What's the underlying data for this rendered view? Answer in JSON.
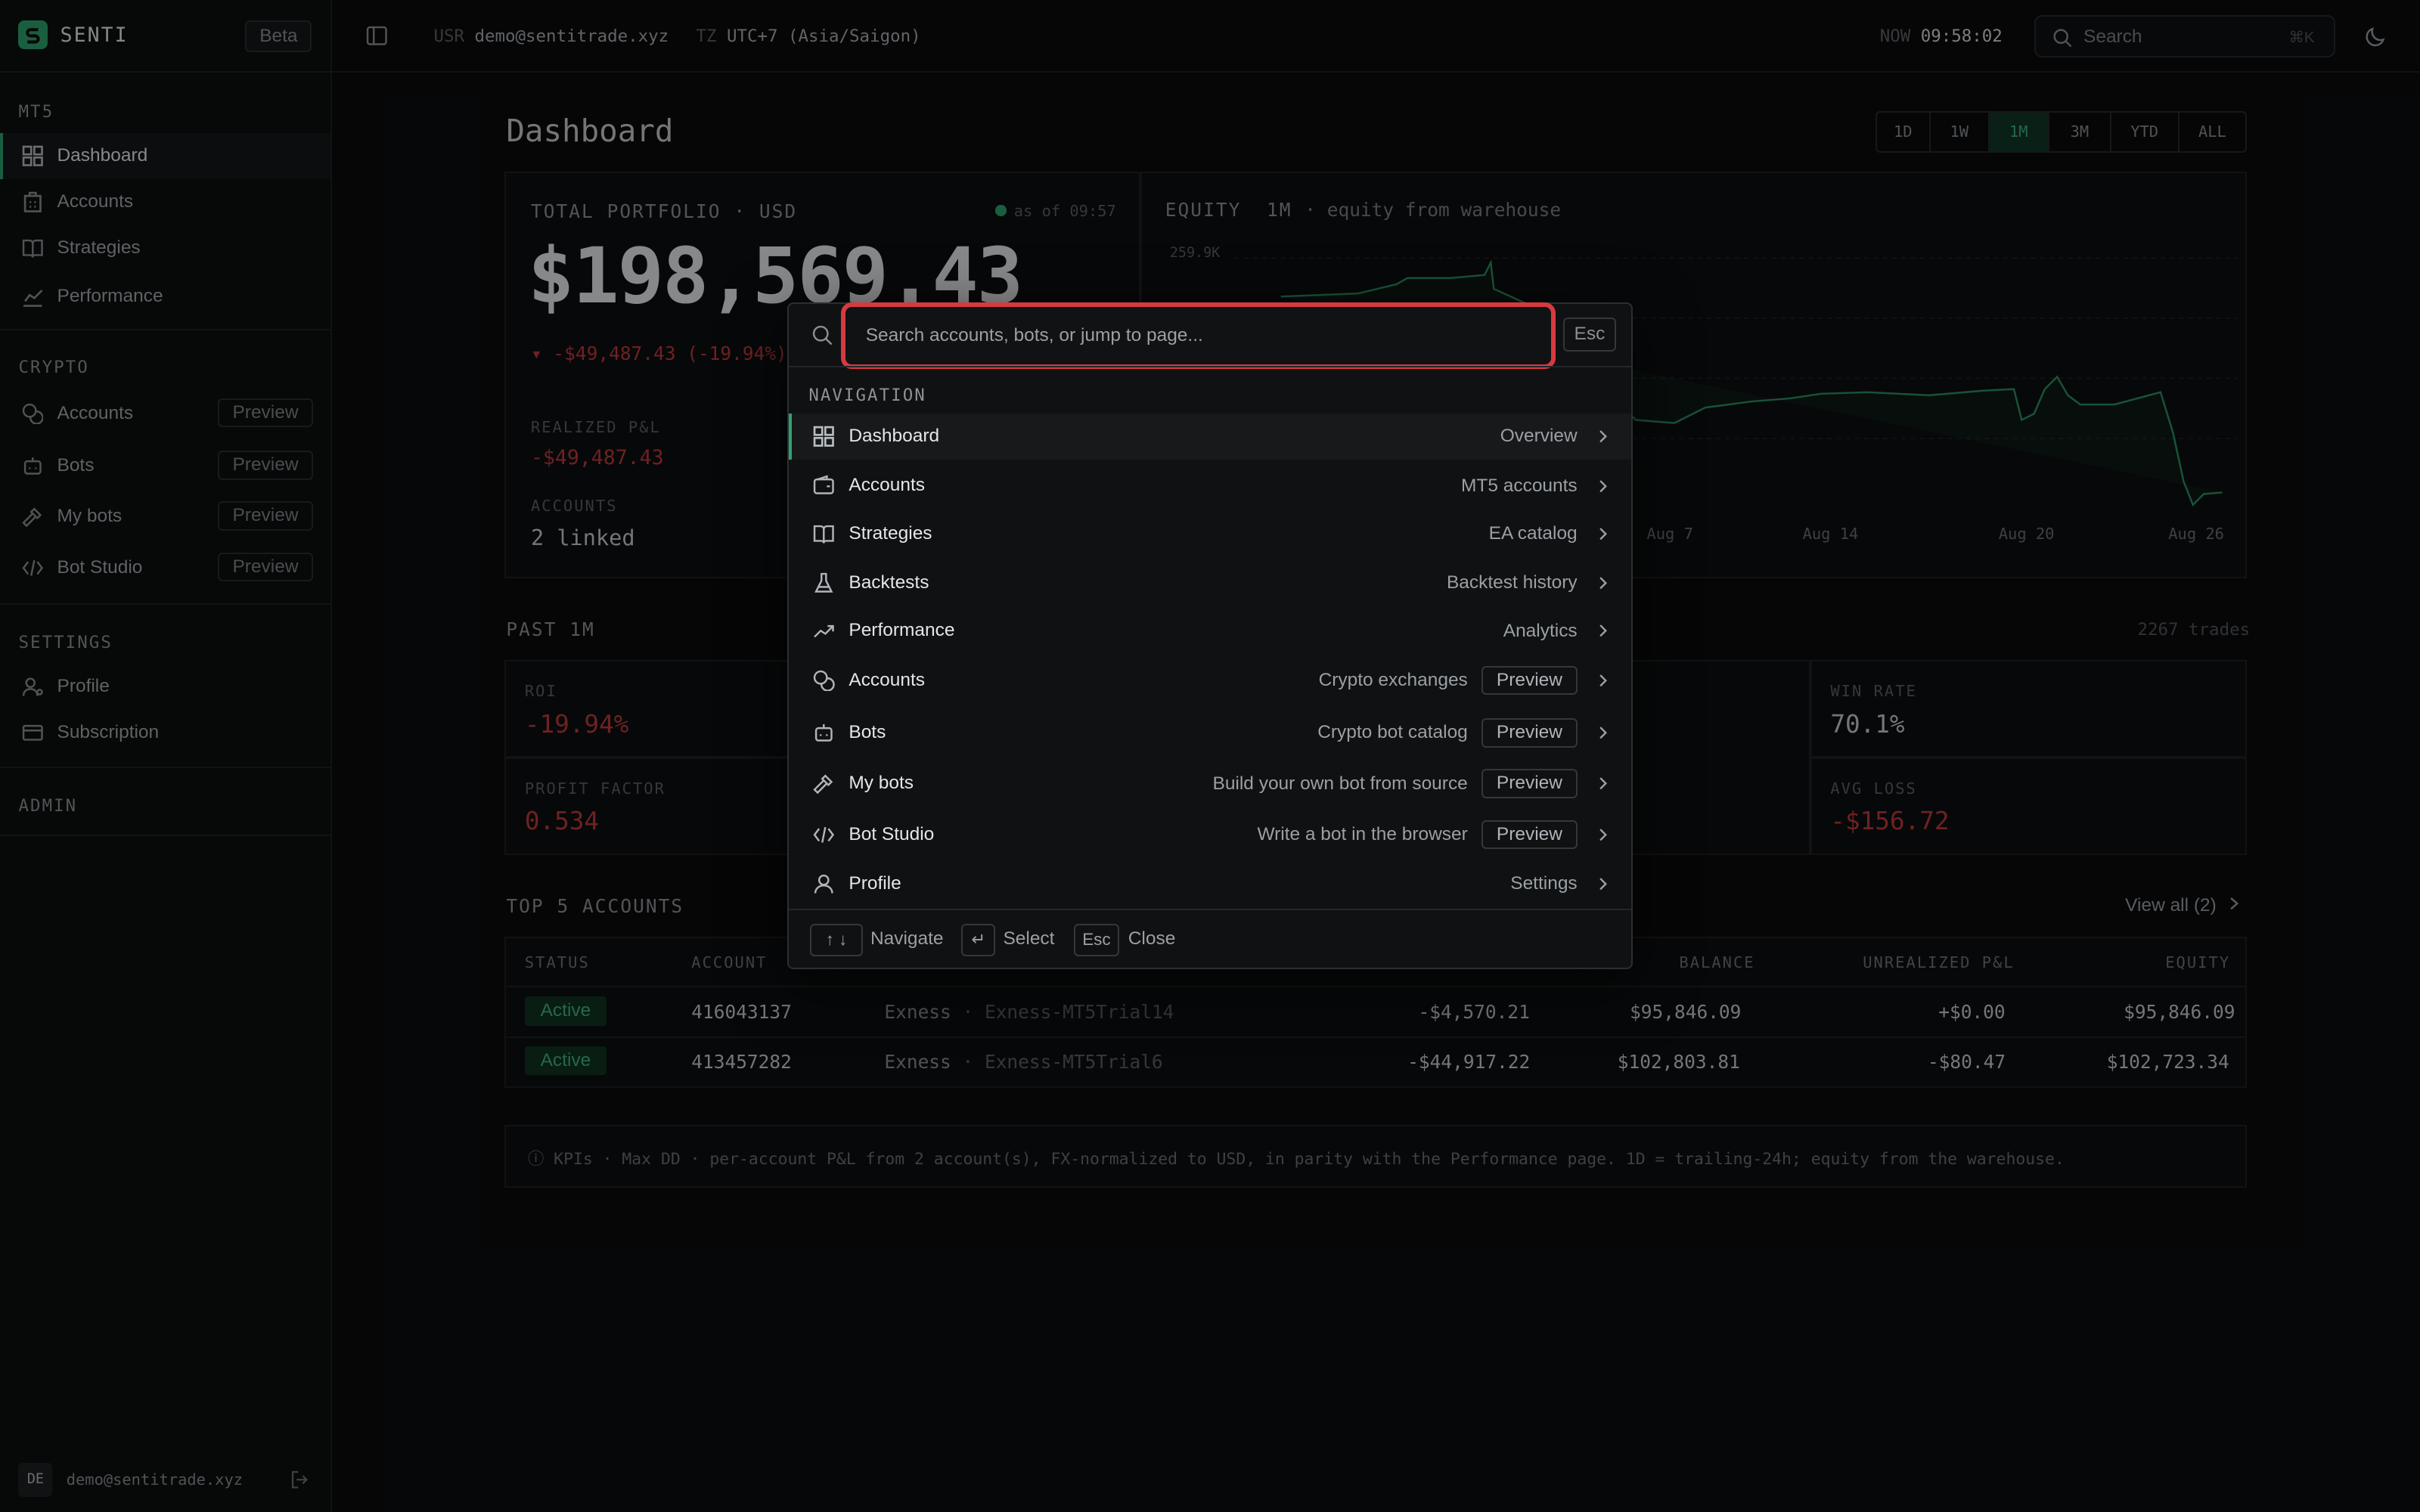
{
  "brand": {
    "name": "SENTI",
    "badge": "Beta"
  },
  "sidebar": {
    "sections": [
      {
        "label": "MT5",
        "items": [
          {
            "label": "Dashboard",
            "icon": "grid-icon",
            "active": true
          },
          {
            "label": "Accounts",
            "icon": "building-icon"
          },
          {
            "label": "Strategies",
            "icon": "book-icon"
          },
          {
            "label": "Performance",
            "icon": "chart-line-icon"
          }
        ]
      },
      {
        "label": "CRYPTO",
        "items": [
          {
            "label": "Accounts",
            "icon": "coins-icon",
            "badge": "Preview"
          },
          {
            "label": "Bots",
            "icon": "bot-icon",
            "badge": "Preview"
          },
          {
            "label": "My bots",
            "icon": "hammer-icon",
            "badge": "Preview"
          },
          {
            "label": "Bot Studio",
            "icon": "code-icon",
            "badge": "Preview"
          }
        ]
      },
      {
        "label": "SETTINGS",
        "items": [
          {
            "label": "Profile",
            "icon": "user-cog-icon"
          },
          {
            "label": "Subscription",
            "icon": "card-icon"
          }
        ]
      },
      {
        "label": "ADMIN",
        "items": []
      }
    ],
    "user": {
      "initials": "DE",
      "email": "demo@sentitrade.xyz"
    }
  },
  "topbar": {
    "user_label": "USR",
    "user_value": "demo@sentitrade.xyz",
    "tz_label": "TZ",
    "tz_value": "UTC+7 (Asia/Saigon)",
    "now_label": "NOW",
    "now_value": "09:58:02",
    "search_placeholder": "Search",
    "search_shortcut": "⌘K"
  },
  "dashboard": {
    "title": "Dashboard",
    "ranges": [
      "1D",
      "1W",
      "1M",
      "3M",
      "YTD",
      "ALL"
    ],
    "selected_range": "1M",
    "portfolio": {
      "label": "TOTAL PORTFOLIO · USD",
      "as_of": "as of 09:57",
      "value": "$198,569.43",
      "change": "▾ -$49,487.43 (-19.94%)",
      "realized_label": "REALIZED P&L",
      "realized_value": "-$49,487.43",
      "accounts_label": "ACCOUNTS",
      "accounts_value": "2 linked"
    },
    "equity": {
      "label": "EQUITY",
      "range": "1M",
      "source": "· equity from warehouse",
      "ytick": "259.9K",
      "xticks": [
        "Aug 7",
        "Aug 14",
        "Aug 20",
        "Aug 26"
      ]
    },
    "past": {
      "label": "PAST 1M",
      "trades": "2267 trades",
      "kpis": [
        {
          "label": "ROI",
          "value": "-19.94%",
          "tone": "red"
        },
        {
          "label": "WIN RATE",
          "value": "70.1%",
          "tone": "neutral"
        },
        {
          "label": "PROFIT FACTOR",
          "value": "0.534",
          "tone": "red"
        },
        {
          "label": "AVG LOSS",
          "value": "-$156.72",
          "tone": "red"
        }
      ]
    },
    "top_accounts": {
      "label": "TOP 5 ACCOUNTS",
      "view_all": "View all (2)",
      "columns": [
        "STATUS",
        "ACCOUNT",
        "BALANCE",
        "UNREALIZED P&L",
        "EQUITY"
      ],
      "rows": [
        {
          "status": "Active",
          "account": "416043137",
          "broker": "Exness",
          "server": "· Exness-MT5Trial14",
          "pnl": "-$4,570.21",
          "balance": "$95,846.09",
          "unrealized": "+$0.00",
          "equity": "$95,846.09"
        },
        {
          "status": "Active",
          "account": "413457282",
          "broker": "Exness",
          "server": "· Exness-MT5Trial6",
          "pnl": "-$44,917.22",
          "balance": "$102,803.81",
          "unrealized": "-$80.47",
          "equity": "$102,723.34"
        }
      ]
    },
    "note": "ⓘ KPIs · Max DD · per-account P&L from 2 account(s), FX-normalized to USD, in parity with the Performance page. 1D = trailing-24h; equity from the warehouse."
  },
  "palette": {
    "placeholder": "Search accounts, bots, or jump to page...",
    "esc": "Esc",
    "section": "NAVIGATION",
    "items": [
      {
        "label": "Dashboard",
        "hint": "Overview",
        "icon": "grid-icon"
      },
      {
        "label": "Accounts",
        "hint": "MT5 accounts",
        "icon": "wallet-icon"
      },
      {
        "label": "Strategies",
        "hint": "EA catalog",
        "icon": "book-icon"
      },
      {
        "label": "Backtests",
        "hint": "Backtest history",
        "icon": "flask-icon"
      },
      {
        "label": "Performance",
        "hint": "Analytics",
        "icon": "trend-icon"
      },
      {
        "label": "Accounts",
        "hint": "Crypto exchanges",
        "badge": "Preview",
        "icon": "coins-icon"
      },
      {
        "label": "Bots",
        "hint": "Crypto bot catalog",
        "badge": "Preview",
        "icon": "bot-icon"
      },
      {
        "label": "My bots",
        "hint": "Build your own bot from source",
        "badge": "Preview",
        "icon": "hammer-icon"
      },
      {
        "label": "Bot Studio",
        "hint": "Write a bot in the browser",
        "badge": "Preview",
        "icon": "code-icon"
      },
      {
        "label": "Profile",
        "hint": "Settings",
        "icon": "user-icon"
      }
    ],
    "footer": {
      "navigate_keys": "↑ ↓",
      "navigate": "Navigate",
      "select_key": "↵",
      "select": "Select",
      "close_key": "Esc",
      "close": "Close"
    }
  },
  "colors": {
    "accent": "#2ea36f",
    "negative": "#c0393b",
    "focus_ring": "#d63a3f"
  }
}
